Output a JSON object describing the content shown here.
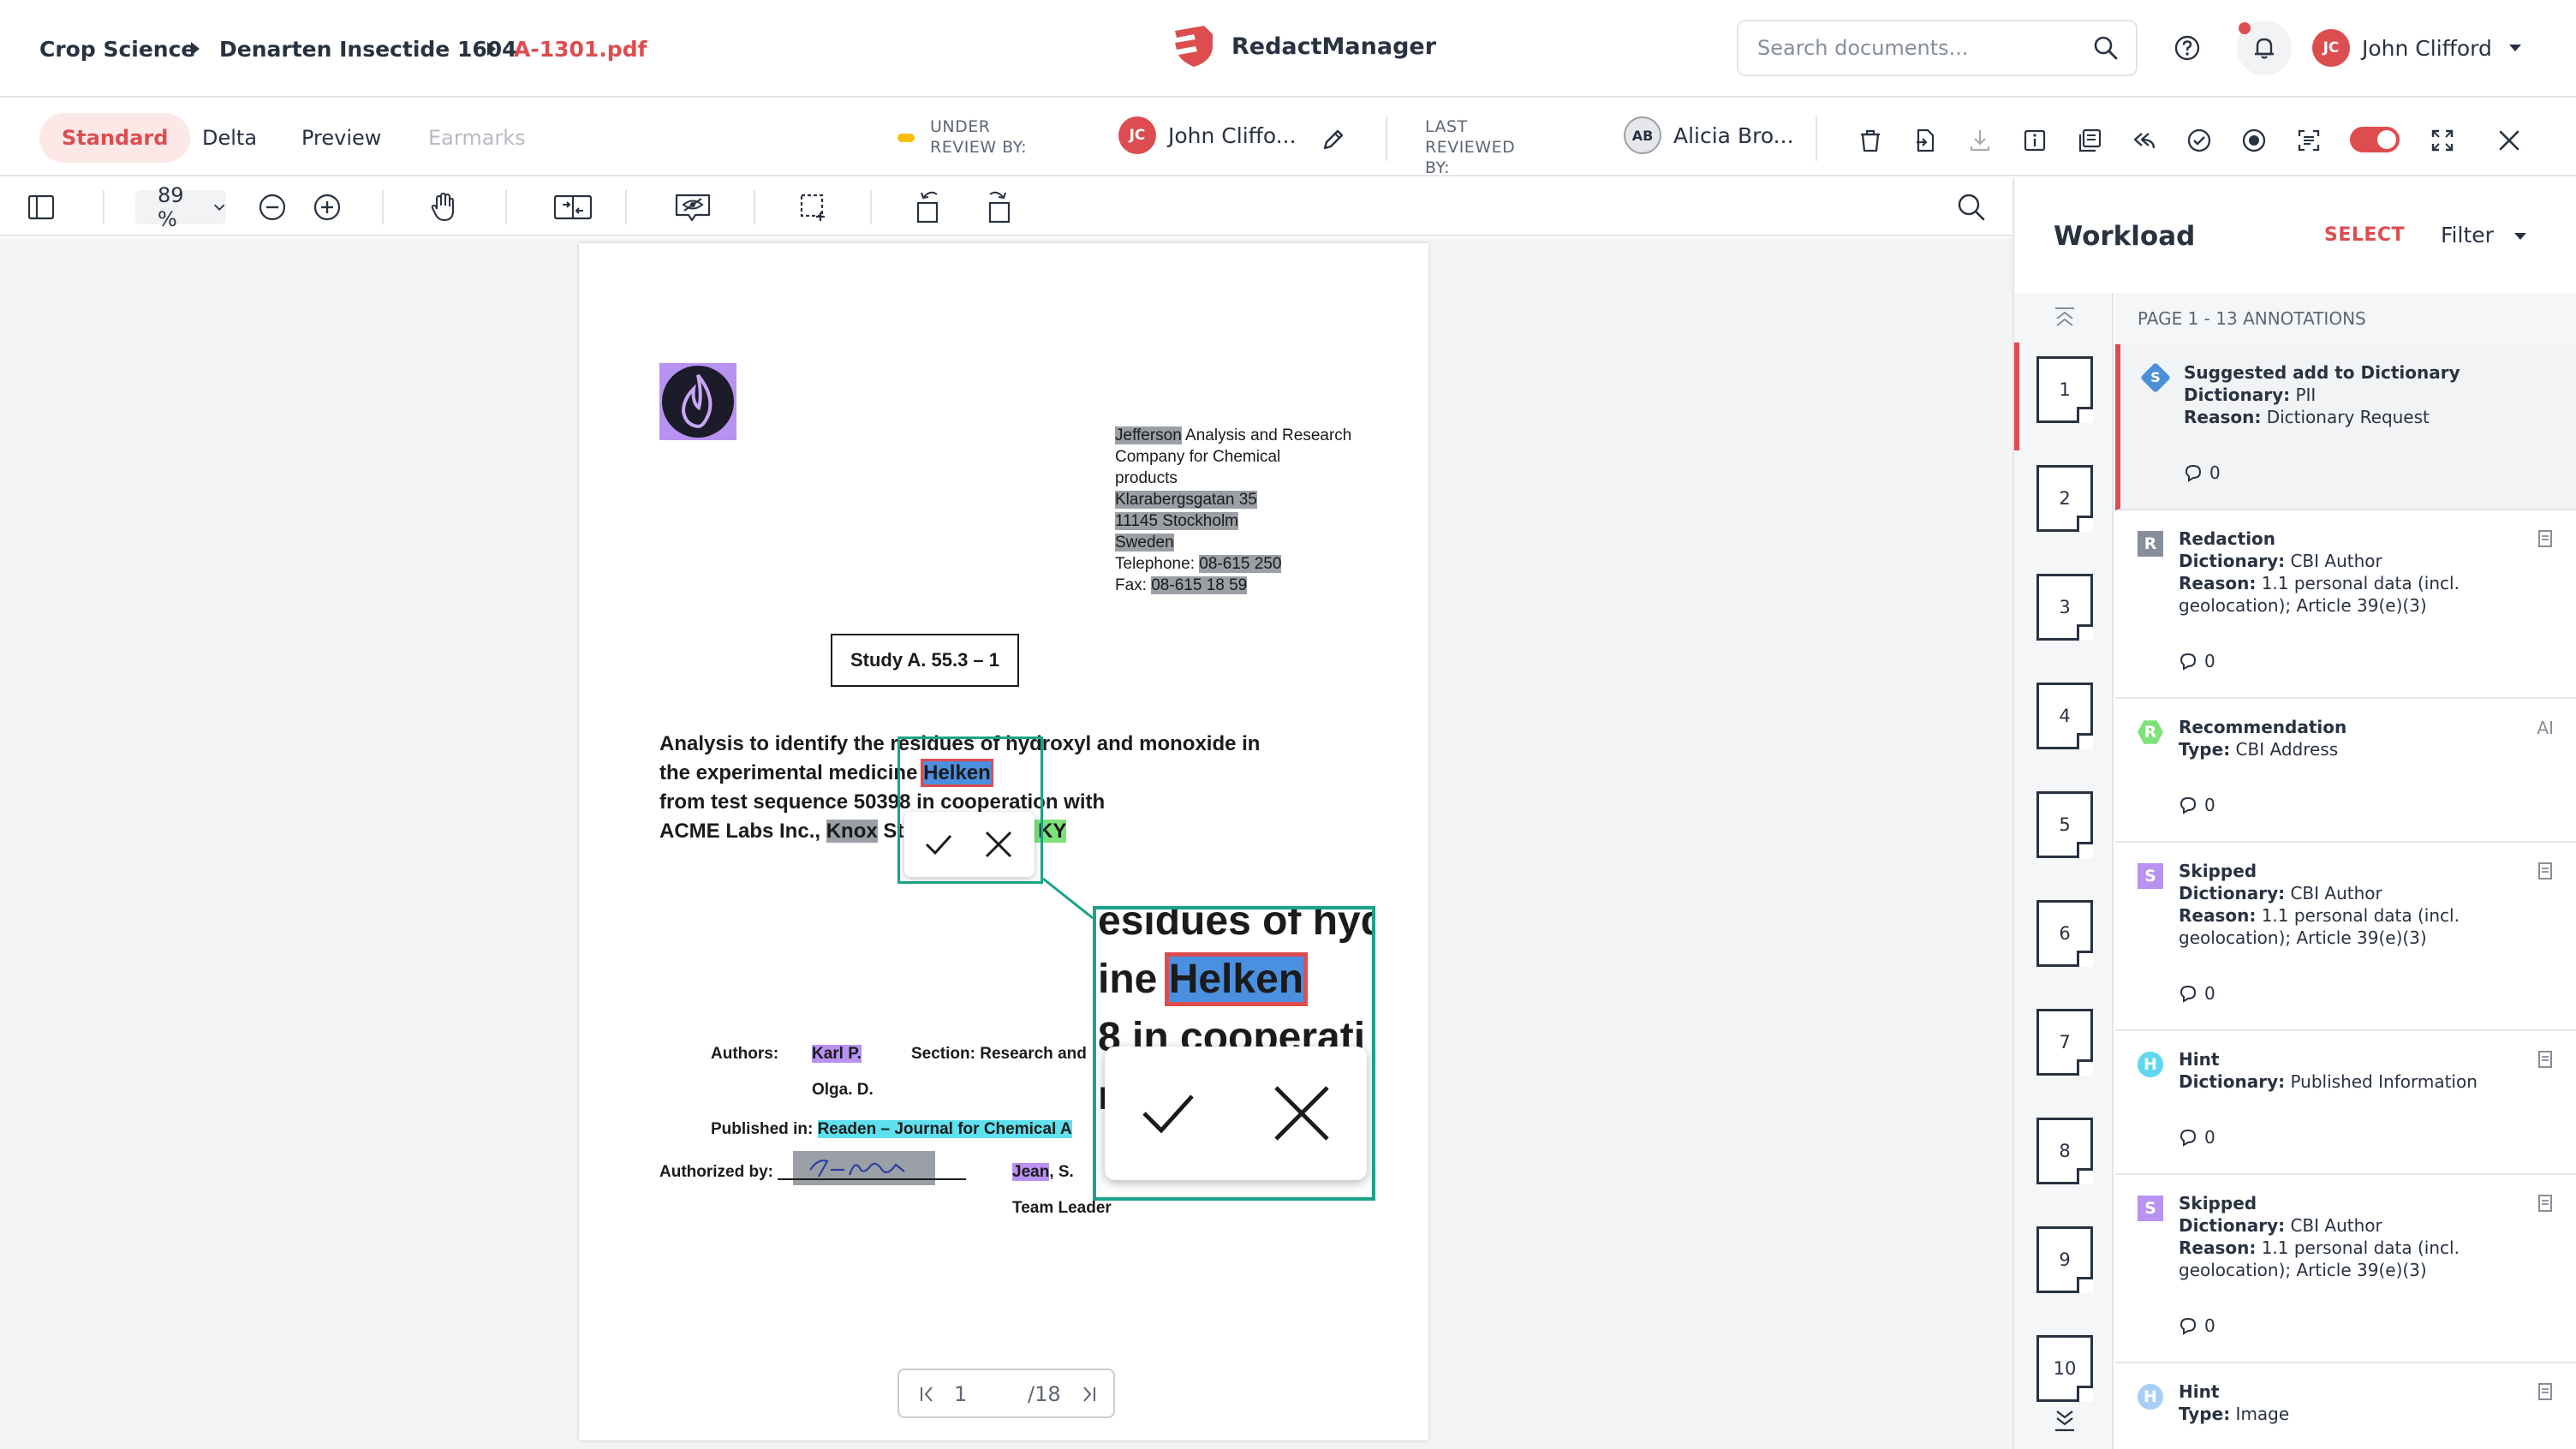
{
  "header": {
    "breadcrumb": [
      "Crop Science",
      "Denarten Insectide 1604",
      "A-1301.pdf"
    ],
    "app_name": "RedactManager",
    "search_placeholder": "Search documents...",
    "user": {
      "initials": "JC",
      "name": "John Clifford"
    }
  },
  "tabs": [
    {
      "label": "Standard",
      "state": "active"
    },
    {
      "label": "Delta",
      "state": "normal"
    },
    {
      "label": "Preview",
      "state": "normal"
    },
    {
      "label": "Earmarks",
      "state": "disabled"
    }
  ],
  "review": {
    "under_review_label": "UNDER REVIEW BY:",
    "under_review_initials": "JC",
    "under_review_name": "John Cliffo...",
    "last_reviewed_label": "LAST REVIEWED BY:",
    "last_reviewed_initials": "AB",
    "last_reviewed_name": "Alicia Bro..."
  },
  "viewer": {
    "zoom": "89 %",
    "current_page": "1",
    "total_pages": "/18"
  },
  "document": {
    "company": [
      "Jefferson",
      " Analysis and Research",
      "Company for Chemical",
      "products",
      "Klarabergsgatan 35",
      "11145 Stockholm",
      "Sweden"
    ],
    "telephone_label": "Telephone:",
    "telephone_value": "08-615 250",
    "fax_label": "Fax:",
    "fax_value": "08-615 18 59",
    "study": "Study A. 55.3 – 1",
    "title": {
      "l1": "Analysis to identify the residues of hydroxyl and monoxide in",
      "l2a": "the experimental medicine ",
      "l2b": "Helken",
      "l3": "from test sequence 50398 in cooperation with",
      "l4a": "ACME Labs Inc., ",
      "l4b": "Knox",
      "l4c": " Str",
      "l4d": "337, KY"
    },
    "authors_label": "Authors:",
    "author1": "Karl P.",
    "author2": "Olga. D.",
    "section": "Section: Research and",
    "published_label": "Published in:",
    "published_value": "Readen – Journal for Chemical A",
    "authorized_label": "Authorized by:",
    "signer": "Jean",
    "signer_rest": ", S.",
    "signer_role": "Team Leader",
    "zoom": {
      "l1": "esidues of hyd",
      "l2a": "ine ",
      "l2b": "Helken",
      "l3": "8 in cooperati",
      "l4": "re"
    }
  },
  "workload": {
    "title": "Workload",
    "select": "SELECT",
    "filter": "Filter",
    "section_header": "PAGE 1 - 13 ANNOTATIONS",
    "pages": [
      "1",
      "2",
      "3",
      "4",
      "5",
      "6",
      "7",
      "8",
      "9",
      "10"
    ],
    "annotations": [
      {
        "badge": "S",
        "color": "#4a90d9",
        "shape": "diamond",
        "type": "Suggested add to Dictionary",
        "k1": "Dictionary:",
        "v1": " PII",
        "k2": "Reason:",
        "v2": " Dictionary Request",
        "comments": "0"
      },
      {
        "badge": "R",
        "color": "#868e9b",
        "shape": "square",
        "type": "Redaction",
        "k1": "Dictionary:",
        "v1": " CBI Author",
        "k2": "Reason:",
        "v2": " 1.1 personal data (incl. geolocation); Article 39(e)(3)",
        "comments": "0"
      },
      {
        "badge": "R",
        "color": "#7ee27a",
        "shape": "hex",
        "type": "Recommendation",
        "k1": "Type:",
        "v1": " CBI Address",
        "k2": "",
        "v2": "",
        "comments": "0",
        "side": "AI"
      },
      {
        "badge": "S",
        "color": "#b892f0",
        "shape": "square",
        "type": "Skipped",
        "k1": "Dictionary:",
        "v1": " CBI Author",
        "k2": "Reason:",
        "v2": " 1.1 personal data (incl. geolocation); Article 39(e)(3)",
        "comments": "0"
      },
      {
        "badge": "H",
        "color": "#5fd7ee",
        "shape": "circle",
        "type": "Hint",
        "k1": "Dictionary:",
        "v1": " Published Information",
        "k2": "",
        "v2": "",
        "comments": "0"
      },
      {
        "badge": "S",
        "color": "#b892f0",
        "shape": "square",
        "type": "Skipped",
        "k1": "Dictionary:",
        "v1": " CBI Author",
        "k2": "Reason:",
        "v2": " 1.1 personal data (incl. geolocation); Article 39(e)(3)",
        "comments": "0"
      },
      {
        "badge": "H",
        "color": "#a9cdf5",
        "shape": "circle",
        "type": "Hint",
        "k1": "Type:",
        "v1": " Image",
        "k2": "",
        "v2": "",
        "comments": ""
      }
    ]
  },
  "colors": {
    "accent": "#dd4d50",
    "teal": "#1aa38a",
    "under_review_dot": "#fdbd00"
  }
}
